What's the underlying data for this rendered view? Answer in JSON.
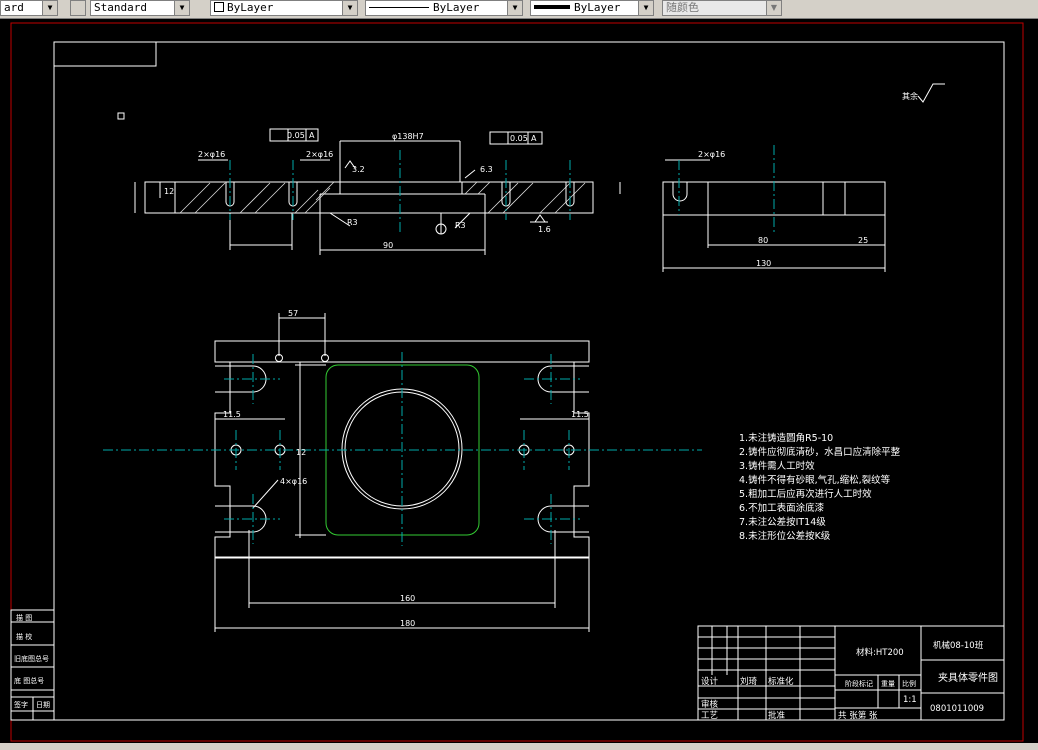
{
  "toolbar": {
    "text_style_partial": "ard",
    "dim_style": "Standard",
    "layer": "ByLayer",
    "linetype": "ByLayer",
    "lineweight": "ByLayer",
    "color": "随颜色"
  },
  "notes": [
    "1.未注铸造圆角R5-10",
    "2.铸件应彻底清砂，水昌口应清除平整",
    "3.铸件需人工时效",
    "4.铸件不得有砂眼,气孔,缩松,裂纹等",
    "5.粗加工后应再次进行人工时效",
    "6.不加工表面涂底漆",
    "7.未注公差按IT14级",
    "8.未注形位公差按K级"
  ],
  "title_block": {
    "class": "机械08-10班",
    "material": "材料:HT200",
    "part_name": "夹具体零件图",
    "number": "0801011009",
    "scale": "1:1",
    "designer_label": "设计",
    "designer": "刘琦",
    "standard_label": "标准化",
    "reviewer_label": "审核",
    "process_label": "工艺",
    "approve_label": "批准",
    "stage_label": "阶段标记",
    "weight_label": "重量",
    "ratio_label": "比例",
    "sheets_label": "共   张第   张"
  },
  "left_block": [
    "描 图",
    "描 校",
    "旧底图总号",
    "底 图总号",
    "签字",
    "日期"
  ],
  "dims": {
    "d1": "0.05",
    "d2": "0.05",
    "d3": "φ138H7",
    "d4": "90",
    "d5": "R3",
    "d6": "R3",
    "d7": "1.6",
    "d8": "6.3",
    "d9": "80",
    "d10": "25",
    "d11": "130",
    "d12": "57",
    "d13": "11.5",
    "d14": "11.5",
    "d15": "160",
    "d16": "180",
    "d17": "4×φ16",
    "d18": "12",
    "d19": "12",
    "d20": "3.2",
    "d21": "2×φ16",
    "d22": "A",
    "d23": "A",
    "d24": "其余"
  },
  "colors": {
    "bg": "#000000",
    "line": "#ffffff",
    "axis": "#00aaaa",
    "frame": "#c00000",
    "highlight": "#33cc33"
  }
}
